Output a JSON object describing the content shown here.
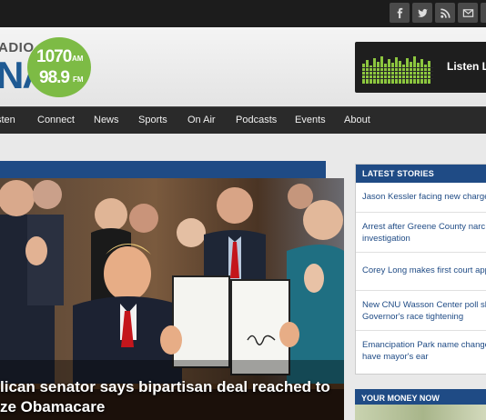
{
  "social": {
    "icons": [
      "facebook-icon",
      "twitter-icon",
      "rss-icon",
      "email-icon",
      "share-icon"
    ]
  },
  "logo": {
    "radio": "ADIO",
    "na": "NA",
    "am_freq": "1070",
    "am": "AM",
    "fm_freq": "98.9",
    "fm": "FM",
    "brand_color": "#1f5a93",
    "circle_color": "#7dbb45"
  },
  "listen": {
    "label": "Listen L"
  },
  "nav": {
    "items": [
      "sten",
      "Connect",
      "News",
      "Sports",
      "On Air",
      "Podcasts",
      "Events",
      "About"
    ]
  },
  "featured": {
    "headline_line1": "lican senator says bipartisan deal reached to",
    "headline_line2": "ze Obamacare",
    "accent": "#1f4b85"
  },
  "latest": {
    "title": "LATEST STORIES",
    "stories": [
      {
        "lines": [
          "Jason Kessler facing new charge"
        ]
      },
      {
        "lines": [
          "Arrest after Greene County narc",
          "investigation"
        ]
      },
      {
        "lines": [
          "Corey Long makes first court app"
        ]
      },
      {
        "lines": [
          "New CNU Wasson Center poll sh",
          "Governor's race tightening"
        ]
      },
      {
        "lines": [
          "Emancipation Park name change",
          "have mayor's ear"
        ]
      }
    ]
  },
  "money": {
    "title": "YOUR MONEY NOW"
  }
}
